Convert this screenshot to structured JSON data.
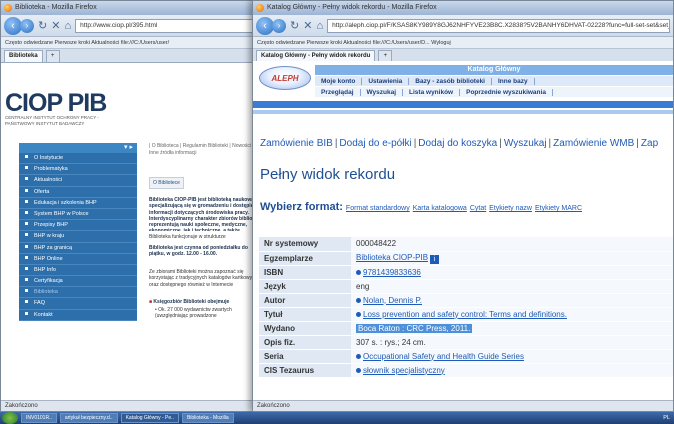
{
  "window_left": {
    "title": "Biblioteka - Mozilla Firefox",
    "url": "http://www.ciop.pl/395.html",
    "bookmarks": "Często odwiedzane   Pierwsze kroki   Aktualności   file:///C:/Users/user/",
    "tab": "Biblioteka",
    "logo": "CIOP PIB",
    "logo_sub": "CENTRALNY INSTYTUT OCHRONY PRACY - PAŃSTWOWY INSTYTUT BADAWCZY",
    "nav": [
      "O Instytucie",
      "Problematyka",
      "Aktualności",
      "Oferta",
      "Edukacja i szkolenia BHP",
      "System BHP w Polsce",
      "Przepisy BHP",
      "BHP w kraju",
      "BHP za granicą",
      "BHP Online",
      "BHP Info",
      "Certyfikacja",
      "Biblioteka",
      "FAQ",
      "Kontakt"
    ],
    "breadcrumb": "| O Biblioteca | Regulamin Biblioteki | Nowości | Inne źródła informacji",
    "button": "O Bibliotece",
    "para1": "Biblioteka CIOP-PIB jest biblioteką naukową specjalizującą się w gromadzeniu i dostępie do informacji dotyczących środowiska pracy. Interdyscyplinarny charakter zbiorów biblioteki reprezentują nauki społeczne, medyczne, ekonomiczne, jak i techniczne, a także słowniki, poradniki, czasopisma, encyklopedie, leksykony i poradniki.",
    "para2": "Biblioteka funkcjonuje w strukturze",
    "para3": "Biblioteka jest czynna od poniedziałku do piątku, w godz. 12.00 - 16.00.",
    "para4": "Ze zbiorami Biblioteki można zapoznać się korzystając z tradycyjnych katalogów kartkowych oraz dostępnego również w Internecie",
    "list_head": "Księgozbiór Biblioteki obejmuje",
    "list_item": "Ok. 27 000 wydawnictw zwartych (uwzględniając prowadzone",
    "status": "Zakończono"
  },
  "window_right": {
    "title": "Katalog Główny - Pełny widok rekordu - Mozilla Firefox",
    "url": "http://aleph.ciop.pl/F/KSAS8KY989Y8GJ62NHFYVE23B8C.X2838?5V2BANHY6DHVAT-02228?func=full-set-set&set_number",
    "bookmarks": "Często odwiedzane   Pierwsze kroki   Aktualności   file:///C:/Users/user/D...   Wyloguj",
    "tab": "Katalog Główny - Pełny widok rekordu",
    "aleph": "ALEPH",
    "katalog": "Katalog Główny",
    "menu1": [
      "Moje konto",
      "Ustawienia",
      "Bazy - zasób biblioteki",
      "Inne bazy"
    ],
    "menu2": [
      "Przeglądaj",
      "Wyszukaj",
      "Lista wyników",
      "Poprzednie wyszukiwania"
    ],
    "actions": [
      "Zamówienie BIB",
      "Dodaj do e-półki",
      "Dodaj do koszyka",
      "Wyszukaj",
      "Zamówienie WMB",
      "Zap"
    ],
    "heading": "Pełny widok rekordu",
    "format_label": "Wybierz format:",
    "formats": [
      "Format standardowy",
      "Karta katalogowa",
      "Cytat",
      "Etykiety nazw",
      "Etykiety MARC"
    ],
    "record": [
      {
        "k": "Nr systemowy",
        "v": "000048422"
      },
      {
        "k": "Egzemplarze",
        "v": "Biblioteka CIOP-PIB"
      },
      {
        "k": "ISBN",
        "v": "9781439833636"
      },
      {
        "k": "Język",
        "v": "eng"
      },
      {
        "k": "Autor",
        "v": "Nolan, Dennis P."
      },
      {
        "k": "Tytuł",
        "v": "Loss prevention and safety control: Terms and definitions."
      },
      {
        "k": "Wydano",
        "v": "Boca Raton : CRC Press, 2011."
      },
      {
        "k": "Opis fiz.",
        "v": "307 s. : rys.; 24 cm."
      },
      {
        "k": "Seria",
        "v": "Occupational Safety and Health Guide Series"
      },
      {
        "k": "CIS Tezaurus",
        "v": "słownik specjalistyczny"
      }
    ],
    "status": "Zakończono"
  },
  "taskbar": {
    "items": [
      "INV0101R..",
      "artykuł bezpieczny.d..",
      "Katalog Główny - Pe..",
      "Biblioteka - Mozilla"
    ],
    "tray": "PL"
  }
}
